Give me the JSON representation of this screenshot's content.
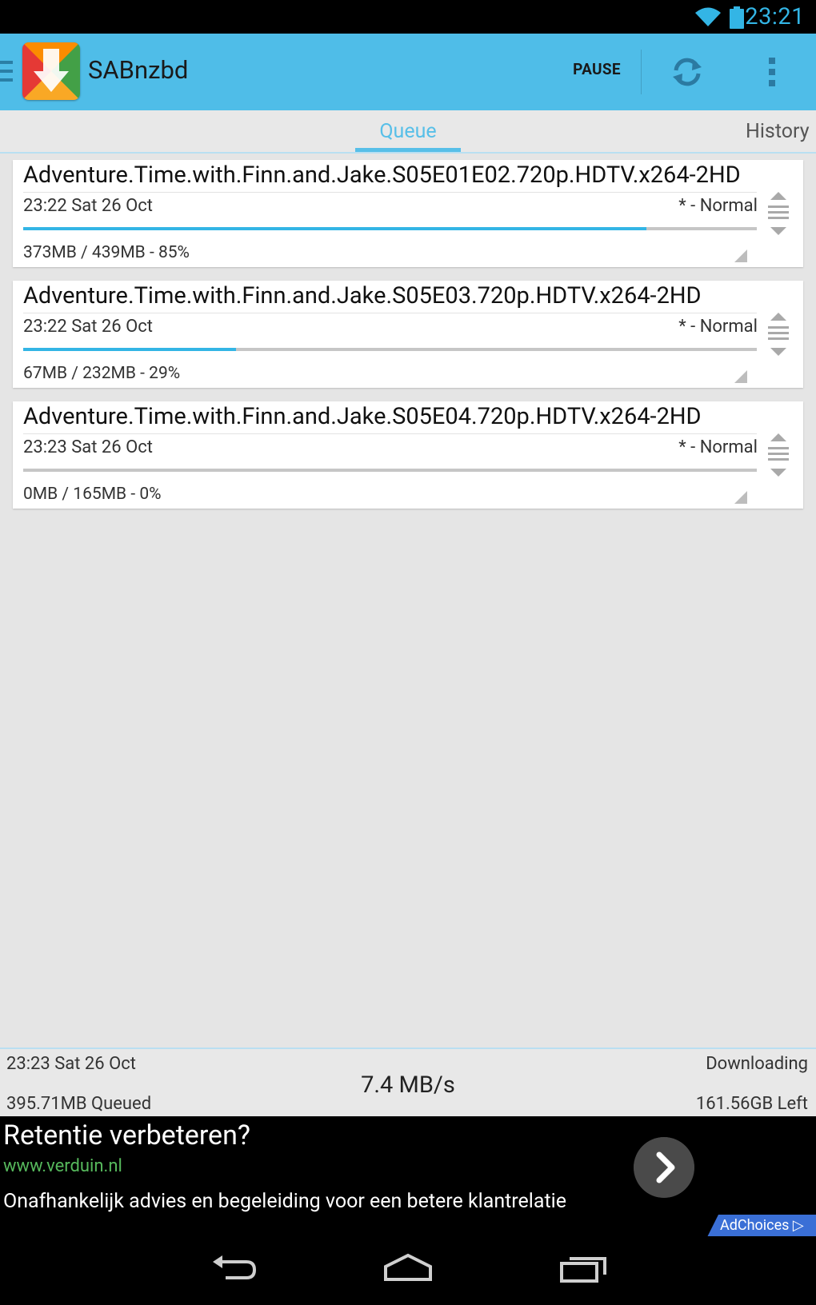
{
  "status_bar": {
    "time": "23:21"
  },
  "app": {
    "title": "SABnzbd",
    "pause_label": "PAUSE"
  },
  "tabs": [
    {
      "label": "Queue",
      "selected": true
    },
    {
      "label": "History",
      "selected": false
    }
  ],
  "queue": [
    {
      "name": "Adventure.Time.with.Finn.and.Jake.S05E01E02.720p.HDTV.x264-2HD",
      "time": "23:22 Sat 26 Oct",
      "priority": "* - Normal",
      "size": "373MB / 439MB - 85%",
      "progress": 0.85
    },
    {
      "name": "Adventure.Time.with.Finn.and.Jake.S05E03.720p.HDTV.x264-2HD",
      "time": "23:22 Sat 26 Oct",
      "priority": "* - Normal",
      "size": "67MB / 232MB - 29%",
      "progress": 0.29
    },
    {
      "name": "Adventure.Time.with.Finn.and.Jake.S05E04.720p.HDTV.x264-2HD",
      "time": "23:23 Sat 26 Oct",
      "priority": "* - Normal",
      "size": "0MB / 165MB - 0%",
      "progress": 0.0
    }
  ],
  "footer": {
    "time": "23:23 Sat 26 Oct",
    "queued": "395.71MB Queued",
    "speed": "7.4 MB/s",
    "status": "Downloading",
    "left": "161.56GB Left"
  },
  "ad": {
    "headline": "Retentie verbeteren?",
    "url": "www.verduin.nl",
    "description": "Onafhankelijk advies en begeleiding voor een betere klantrelatie",
    "adchoices": "AdChoices"
  },
  "colors": {
    "accent": "#33b5e5",
    "actionbar": "#4fbde8",
    "ad_url": "#56b85c"
  }
}
